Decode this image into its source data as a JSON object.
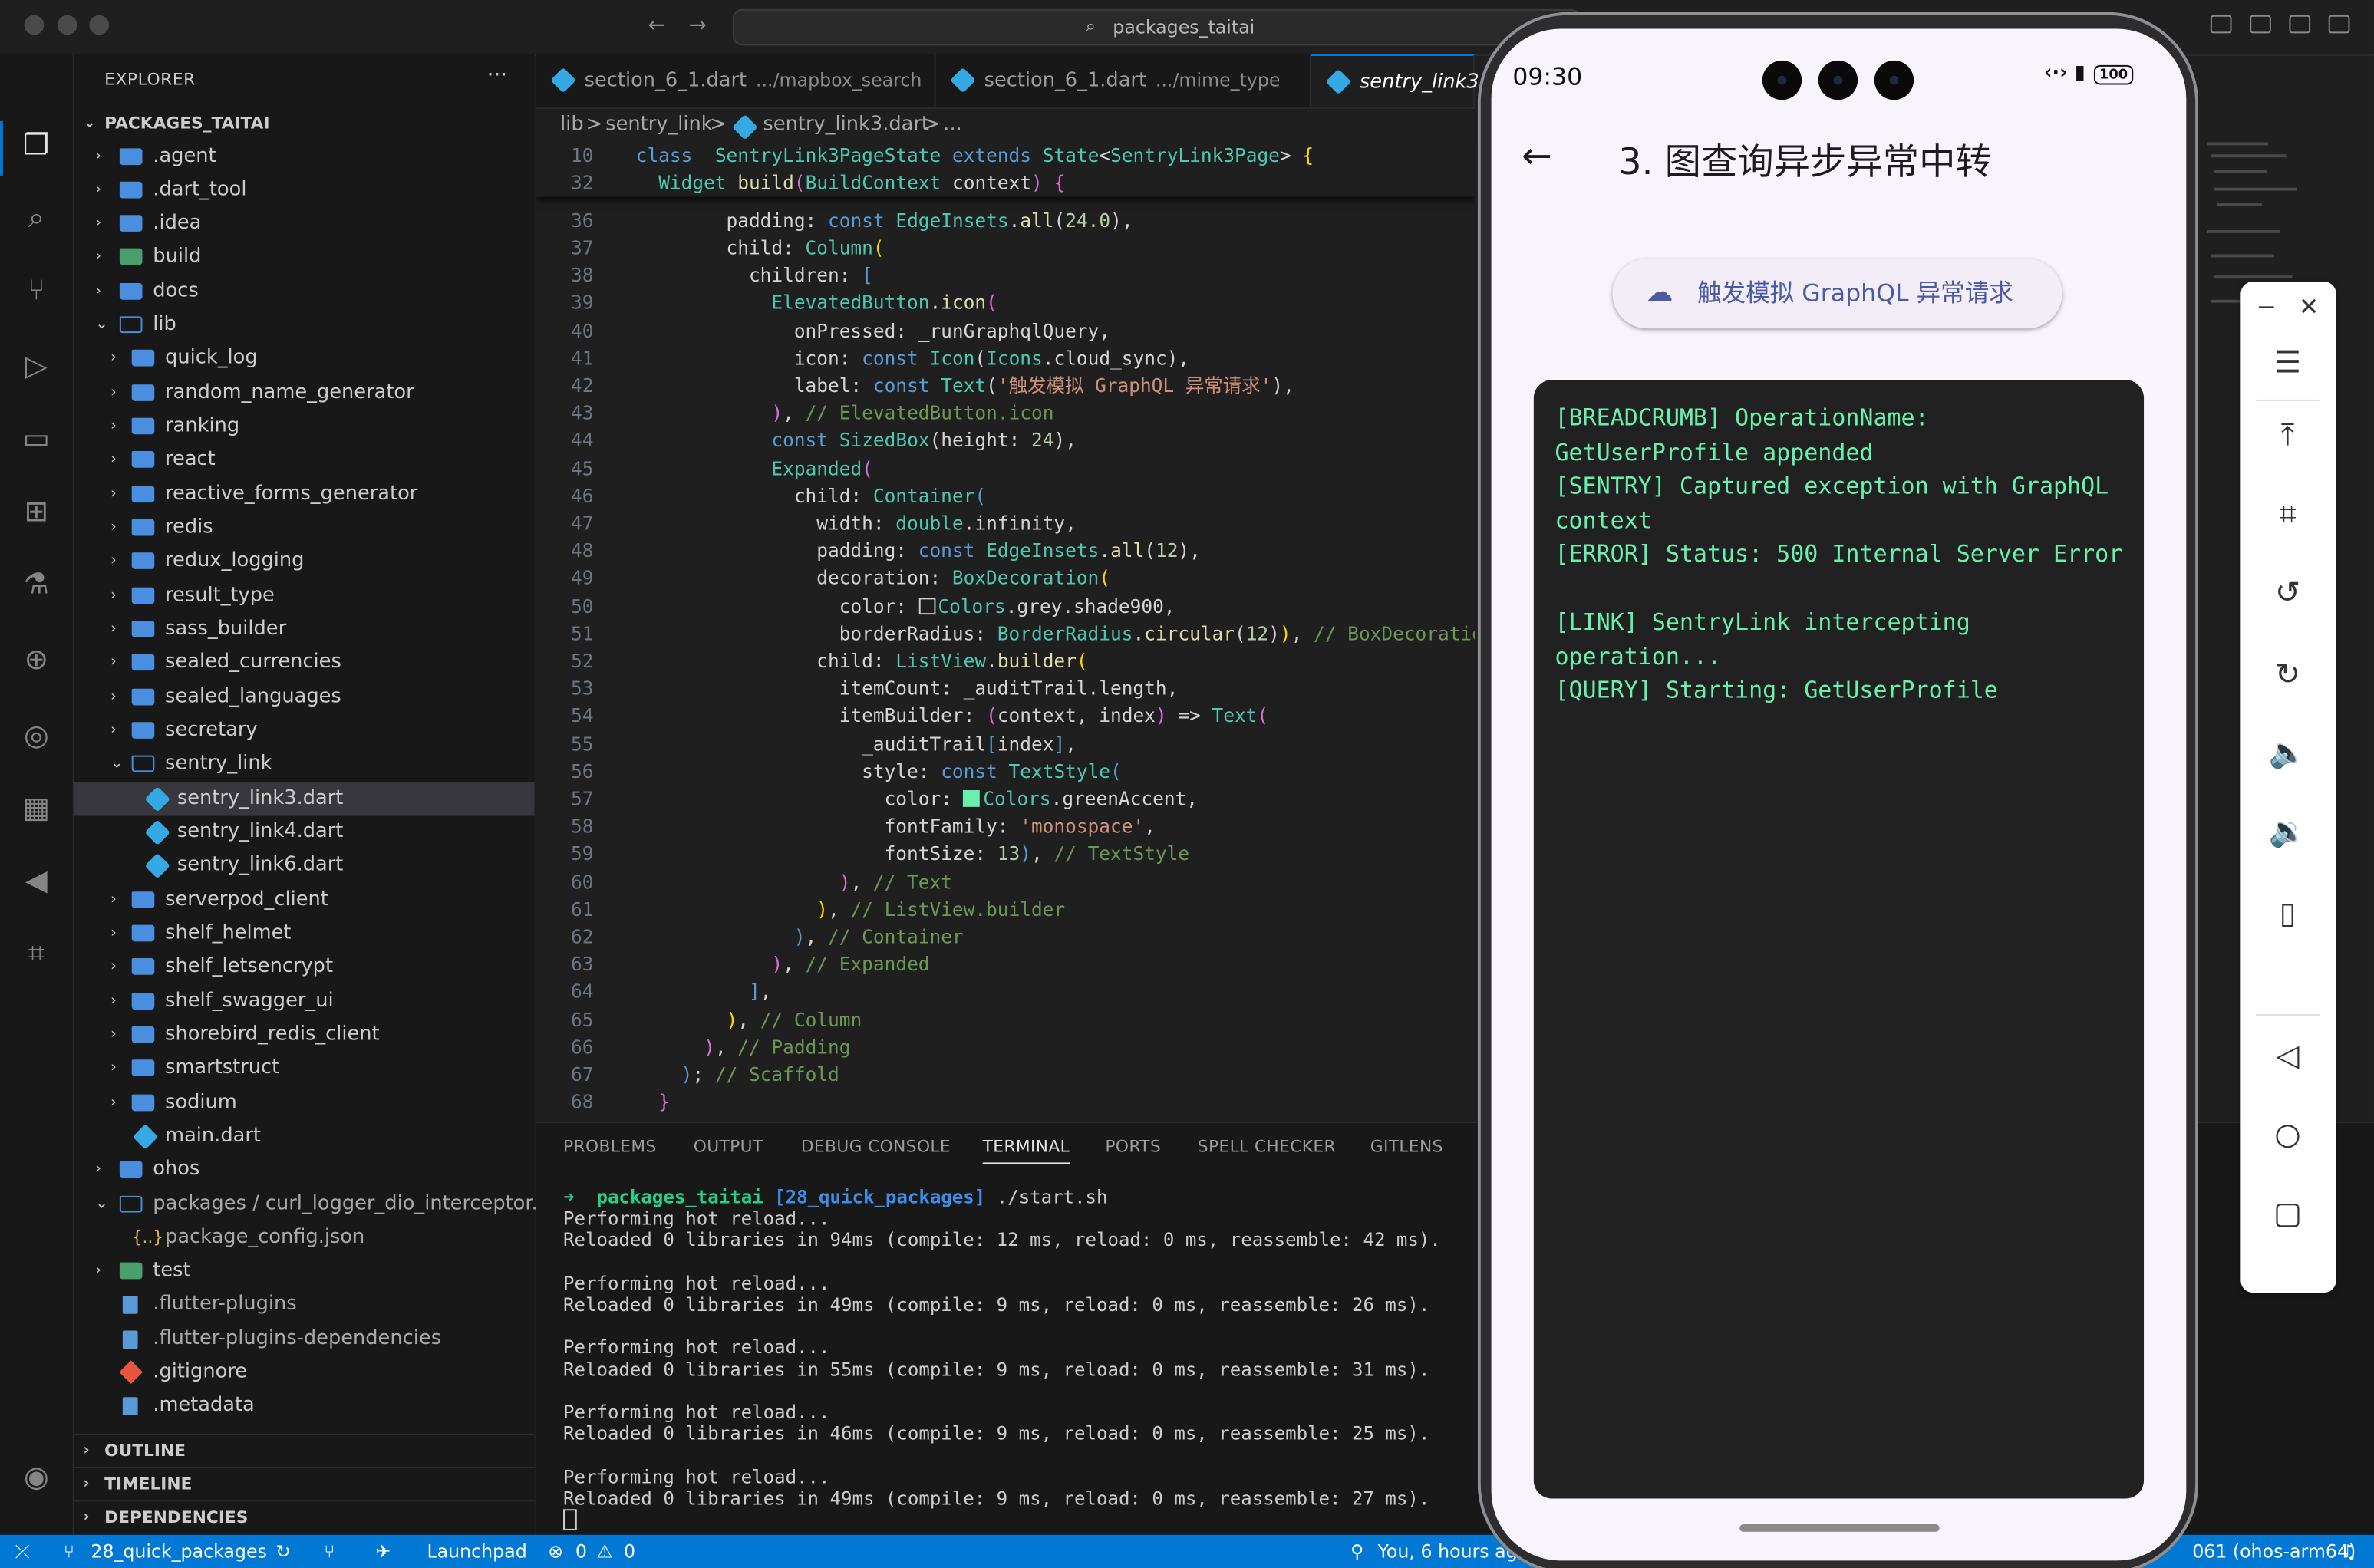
{
  "window": {
    "search_text": "packages_taitai"
  },
  "explorer": {
    "title": "EXPLORER",
    "root": "PACKAGES_TAITAI",
    "items": [
      {
        "label": ".agent"
      },
      {
        "label": ".dart_tool"
      },
      {
        "label": ".idea"
      },
      {
        "label": "build"
      },
      {
        "label": "docs"
      },
      {
        "label": "lib"
      },
      {
        "label": "quick_log"
      },
      {
        "label": "random_name_generator"
      },
      {
        "label": "ranking"
      },
      {
        "label": "react"
      },
      {
        "label": "reactive_forms_generator"
      },
      {
        "label": "redis"
      },
      {
        "label": "redux_logging"
      },
      {
        "label": "result_type"
      },
      {
        "label": "sass_builder"
      },
      {
        "label": "sealed_currencies"
      },
      {
        "label": "sealed_languages"
      },
      {
        "label": "secretary"
      },
      {
        "label": "sentry_link"
      },
      {
        "label": "sentry_link3.dart"
      },
      {
        "label": "sentry_link4.dart"
      },
      {
        "label": "sentry_link6.dart"
      },
      {
        "label": "serverpod_client"
      },
      {
        "label": "shelf_helmet"
      },
      {
        "label": "shelf_letsencrypt"
      },
      {
        "label": "shelf_swagger_ui"
      },
      {
        "label": "shorebird_redis_client"
      },
      {
        "label": "smartstruct"
      },
      {
        "label": "sodium"
      },
      {
        "label": "main.dart"
      },
      {
        "label": "ohos"
      },
      {
        "label": "packages / curl_logger_dio_interceptor..."
      },
      {
        "label": "package_config.json"
      },
      {
        "label": "test"
      },
      {
        "label": ".flutter-plugins"
      },
      {
        "label": ".flutter-plugins-dependencies"
      },
      {
        "label": ".gitignore"
      },
      {
        "label": ".metadata"
      }
    ],
    "sections": [
      "OUTLINE",
      "TIMELINE",
      "DEPENDENCIES"
    ]
  },
  "tabs": [
    {
      "label": "section_6_1.dart",
      "desc": ".../mapbox_search"
    },
    {
      "label": "section_6_1.dart",
      "desc": ".../mime_type"
    },
    {
      "label": "sentry_link3.",
      "desc": ""
    }
  ],
  "breadcrumbs": [
    "lib",
    ">",
    "sentry_link",
    ">",
    "sentry_link3.dart",
    ">",
    "..."
  ],
  "code_lines": [
    "10",
    "32",
    "36",
    "37",
    "38",
    "39",
    "40",
    "41",
    "42",
    "43",
    "44",
    "45",
    "46",
    "47",
    "48",
    "49",
    "50",
    "51",
    "52",
    "53",
    "54",
    "55",
    "56",
    "57",
    "58",
    "59",
    "60",
    "61",
    "62",
    "63",
    "64",
    "65",
    "66",
    "67",
    "68"
  ],
  "panel": {
    "tabs": [
      "PROBLEMS",
      "OUTPUT",
      "DEBUG CONSOLE",
      "TERMINAL",
      "PORTS",
      "SPELL CHECKER",
      "GITLENS"
    ],
    "prompt_dir": "packages_taitai",
    "prompt_branch": "[28_quick_packages]",
    "prompt_cmd": "./start.sh",
    "hot_reload": "Performing hot reload...",
    "reloads": [
      "Reloaded 0 libraries in 94ms (compile: 12 ms, reload: 0 ms, reassemble: 42 ms).",
      "Reloaded 0 libraries in 49ms (compile: 9 ms, reload: 0 ms, reassemble: 26 ms).",
      "Reloaded 0 libraries in 55ms (compile: 9 ms, reload: 0 ms, reassemble: 31 ms).",
      "Reloaded 0 libraries in 46ms (compile: 9 ms, reload: 0 ms, reassemble: 25 ms).",
      "Reloaded 0 libraries in 49ms (compile: 9 ms, reload: 0 ms, reassemble: 27 ms)."
    ]
  },
  "status": {
    "branch": "28_quick_packages",
    "launchpad": "Launchpad",
    "errors": "0",
    "warnings": "0",
    "blame": "You, 6 hours ago",
    "device": "061 (ohos-arm64)"
  },
  "phone": {
    "time": "09:30",
    "battery": "100",
    "title": "3. 图查询异步异常中转",
    "button_label": "触发模拟 GraphQL 异常请求",
    "logs": [
      "[BREADCRUMB] OperationName: GetUserProfile appended",
      "[SENTRY] Captured exception with GraphQL context",
      "[ERROR] Status: 500 Internal Server Error",
      "[LINK] SentryLink intercepting operation...",
      "[QUERY] Starting: GetUserProfile"
    ]
  },
  "colors": {
    "accent": "#0078d4",
    "log_green": "#69f0ae",
    "console_bg": "#212121"
  }
}
